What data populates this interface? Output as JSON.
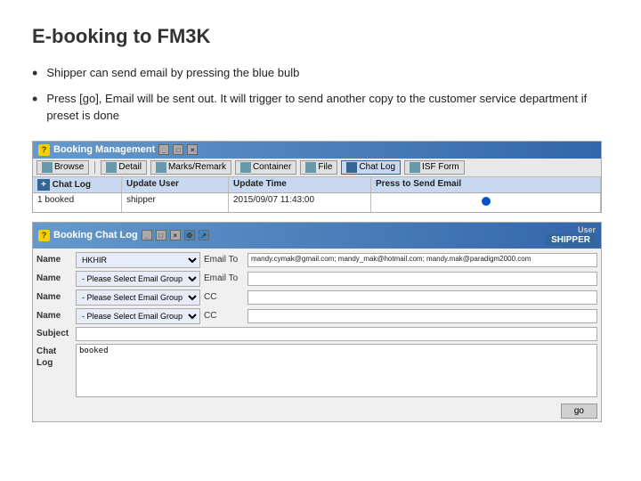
{
  "slide": {
    "title": "E-booking to FM3K",
    "bullets": [
      "Shipper can send email by pressing the blue bulb",
      "Press [go], Email will be sent out. It will trigger to send another copy to the customer service department if preset is done"
    ]
  },
  "booking_management": {
    "title": "Booking Management",
    "toolbar": {
      "buttons": [
        "Browse",
        "Detail",
        "Marks/Remark",
        "Container",
        "File",
        "Chat Log",
        "ISF Form"
      ]
    },
    "table": {
      "headers": [
        "+ Chat Log",
        "Update User",
        "Update Time",
        "Press to Send Email"
      ],
      "rows": [
        {
          "chat_log": "1 booked",
          "user": "shipper",
          "time": "2015/09/07 11:43:00",
          "send": "●"
        }
      ]
    }
  },
  "booking_chat_log": {
    "title": "Booking Chat Log",
    "user_label": "User",
    "user_value": "SHIPPER",
    "rows": [
      {
        "label": "Name",
        "select_value": "HKHIR",
        "email_label": "Email To",
        "email_value": "mandy.cymak@gmail.com; mandy_mak@hotmail.com; mandy.mak@paradigm2000.com"
      },
      {
        "label": "Name",
        "select_value": "Please Select Email Group ▼",
        "email_label": "Email To",
        "email_value": ""
      },
      {
        "label": "Name",
        "select_value": "Please Select Email Group ▼",
        "email_label": "CC",
        "email_value": ""
      },
      {
        "label": "Name",
        "select_value": "Please Select Email Group ▼",
        "email_label": "CC",
        "email_value": ""
      }
    ],
    "subject_label": "Subject",
    "subject_value": "",
    "chatlog_label": "Chat\nLog",
    "chatlog_value": "booked",
    "footer_btn": "go"
  }
}
